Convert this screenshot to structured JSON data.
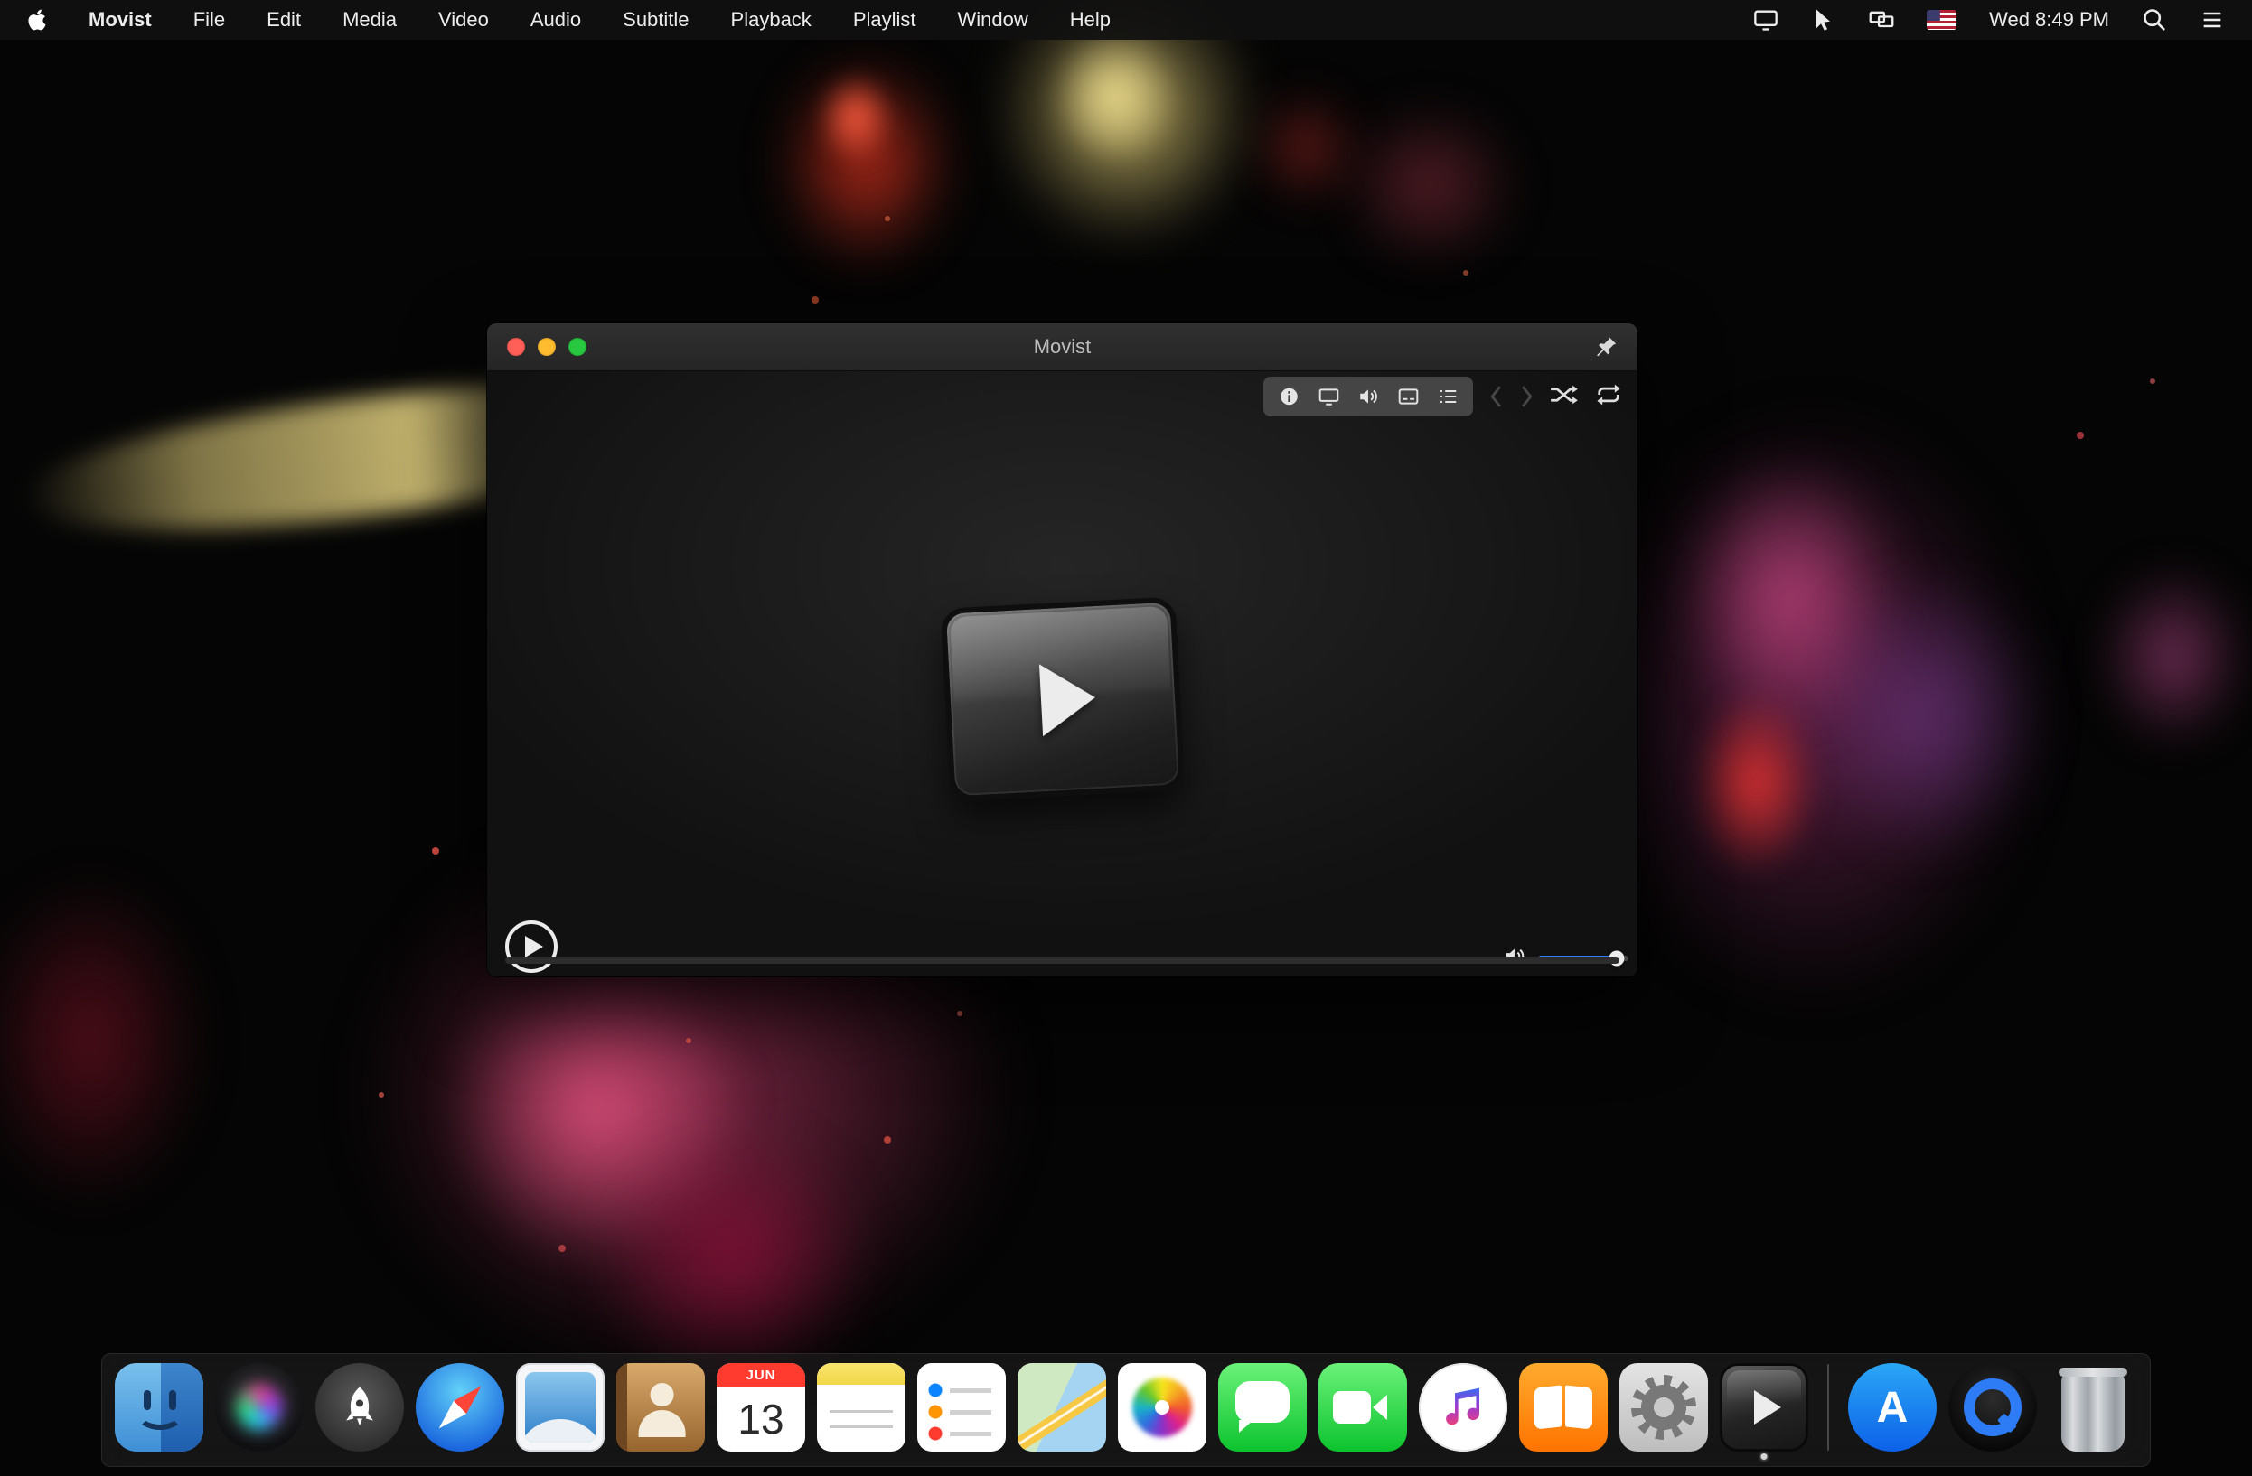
{
  "menubar": {
    "app_name": "Movist",
    "items": [
      "File",
      "Edit",
      "Media",
      "Video",
      "Audio",
      "Subtitle",
      "Playback",
      "Playlist",
      "Window",
      "Help"
    ],
    "status_icons": [
      "screen-sharing-icon",
      "cursor-icon",
      "displays-icon",
      "us-flag-icon",
      "spotlight-search-icon",
      "notification-center-icon"
    ],
    "time": "Wed 8:49 PM"
  },
  "window": {
    "title": "Movist",
    "hud_icons": [
      "info-icon",
      "display-icon",
      "volume-icon",
      "subtitle-icon",
      "playlist-icon"
    ],
    "transport_icons": [
      "previous-icon",
      "next-icon",
      "shuffle-icon",
      "repeat-icon"
    ],
    "volume_percent": 87
  },
  "dock": {
    "items": [
      "finder",
      "siri",
      "launchpad",
      "safari",
      "mail",
      "contacts",
      "calendar",
      "notes",
      "reminders",
      "maps",
      "photos",
      "messages",
      "facetime",
      "itunes",
      "ibooks",
      "system-preferences",
      "movist",
      "app-store",
      "quicktime",
      "trash"
    ],
    "calendar_month": "JUN",
    "calendar_day": "13",
    "app_store_letter": "A"
  },
  "colors": {
    "accent_blue": "#2e7cf6",
    "traffic_red": "#ff5f57",
    "traffic_yellow": "#febc2e",
    "traffic_green": "#28c840"
  }
}
